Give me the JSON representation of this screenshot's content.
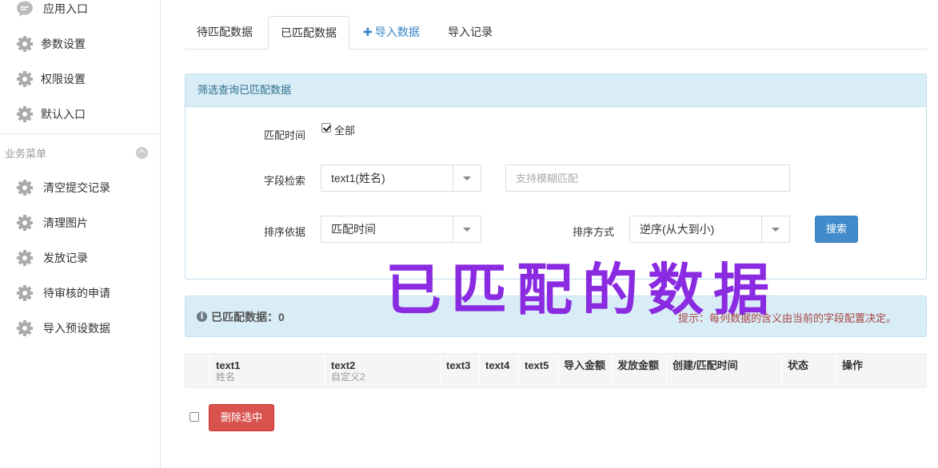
{
  "sidebar": {
    "items": [
      {
        "label": "应用入口",
        "icon": "chat-icon"
      },
      {
        "label": "参数设置",
        "icon": "gear-icon"
      },
      {
        "label": "权限设置",
        "icon": "gear-icon"
      },
      {
        "label": "默认入口",
        "icon": "gear-icon"
      }
    ],
    "group_title": "业务菜单",
    "group_items": [
      {
        "label": "清空提交记录",
        "icon": "gear-icon"
      },
      {
        "label": "清理图片",
        "icon": "gear-icon"
      },
      {
        "label": "发放记录",
        "icon": "gear-icon"
      },
      {
        "label": "待审核的申请",
        "icon": "gear-icon"
      },
      {
        "label": "导入预设数据",
        "icon": "gear-icon"
      }
    ]
  },
  "tabs": [
    {
      "label": "待匹配数据"
    },
    {
      "label": "已匹配数据",
      "active": true
    },
    {
      "label": "导入数据",
      "icon": "plus-icon"
    },
    {
      "label": "导入记录"
    }
  ],
  "filter": {
    "title": "筛选查询已匹配数据",
    "match_time_label": "匹配时间",
    "all_label": "全部",
    "all_checked": true,
    "field_search_label": "字段检索",
    "field_select_value": "text1(姓名)",
    "fuzzy_placeholder": "支持模糊匹配",
    "sort_by_label": "排序依据",
    "sort_by_value": "匹配时间",
    "sort_order_label": "排序方式",
    "sort_order_value": "逆序(从大到小)",
    "search_button": "搜索"
  },
  "overlay_text": "已匹配的数据",
  "summary": {
    "count_label": "已匹配数据：0",
    "tip": "提示：每列数据的含义由当前的字段配置决定。"
  },
  "table": {
    "columns": [
      {
        "title": "text1",
        "sub": "姓名"
      },
      {
        "title": "text2",
        "sub": "自定义2"
      },
      {
        "title": "text3",
        "sub": ""
      },
      {
        "title": "text4",
        "sub": ""
      },
      {
        "title": "text5",
        "sub": ""
      },
      {
        "title": "导入金额",
        "sub": ""
      },
      {
        "title": "发放金额",
        "sub": ""
      },
      {
        "title": "创建/匹配时间",
        "sub": ""
      },
      {
        "title": "状态",
        "sub": ""
      },
      {
        "title": "操作",
        "sub": ""
      }
    ]
  },
  "actions": {
    "delete_button": "删除选中"
  },
  "colors": {
    "accent": "#3a87c8",
    "info_bg": "#d9edf7",
    "danger": "#d9534f",
    "overlay": "#8a2be2"
  }
}
